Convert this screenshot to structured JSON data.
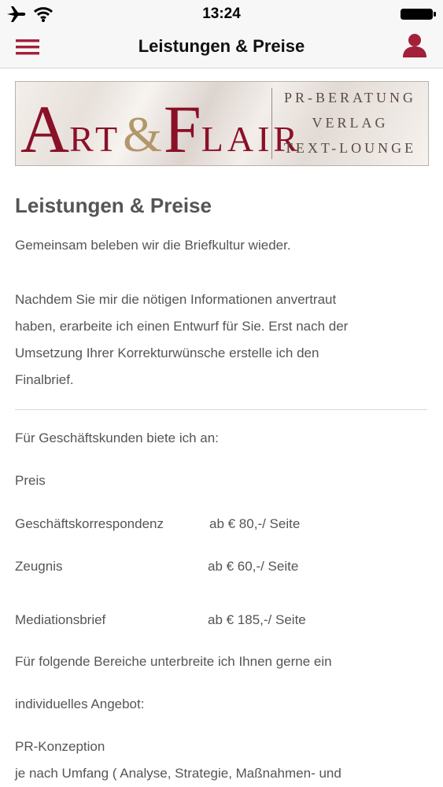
{
  "status_bar": {
    "time": "13:24",
    "icons": [
      "airplane-icon",
      "wifi-icon",
      "battery-icon"
    ]
  },
  "nav": {
    "title": "Leistungen & Preise",
    "menu_icon": "hamburger-menu-icon",
    "user_icon": "user-icon",
    "accent_color": "#a3203a"
  },
  "banner": {
    "logo_text": "ART&FLAIR",
    "lines": [
      "PR-BERATUNG",
      "VERLAG",
      "TEXT-LOUNGE"
    ]
  },
  "main": {
    "heading": "Leistungen & Preise",
    "intro": "Gemeinsam beleben wir die Briefkultur wieder.",
    "paragraph_lines": [
      "Nachdem Sie mir die nötigen Informationen anvertraut",
      "haben, erarbeite ich einen Entwurf für Sie. Erst nach der",
      "Umsetzung Ihrer Korrekturwünsche erstelle ich den",
      "Finalbrief."
    ],
    "business_intro": "Für Geschäftskunden biete ich an:",
    "price_header": "Preis",
    "prices": [
      {
        "label": "Geschäftskorrespondenz",
        "value": "ab € 80,-/ Seite"
      },
      {
        "label": "Zeugnis",
        "value": "ab € 60,-/ Seite"
      },
      {
        "label": "Mediationsbrief",
        "value": "ab € 185,-/ Seite"
      }
    ],
    "offer_line1": "Für folgende Bereiche unterbreite ich Ihnen gerne ein",
    "offer_line2": "individuelles Angebot:",
    "pr_title": "PR-Konzeption",
    "pr_desc": "je nach Umfang ( Analyse, Strategie, Maßnahmen- und"
  }
}
